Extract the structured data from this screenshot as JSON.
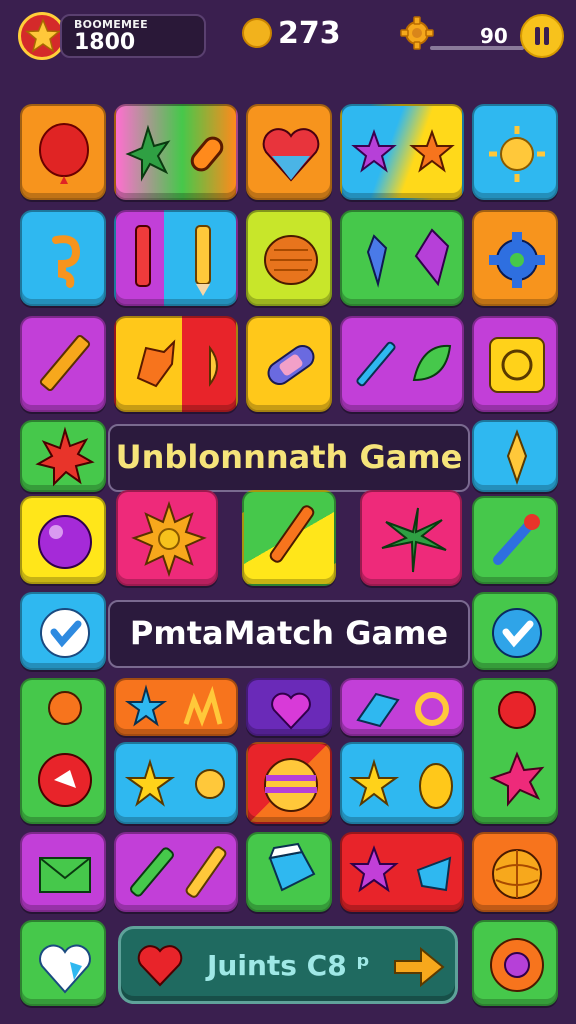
{
  "hud": {
    "score_label": "BOOMEMEE",
    "score_value": "1800",
    "coins_value": "273",
    "moves_value": "90",
    "icons": [
      "star-icon",
      "coin-icon",
      "gear-icon",
      "pause-icon"
    ]
  },
  "banners": {
    "top_text": "Unblonnnath Game",
    "middle_text": "PmtaMatch Game"
  },
  "bottom_button": {
    "label": "Juints C8 ᵖ"
  },
  "colors": {
    "background": "#3a1f4f",
    "accent": "#f7c21c",
    "banner_text_top": "#f6e47a",
    "bottom_button": "#1f6a60"
  }
}
